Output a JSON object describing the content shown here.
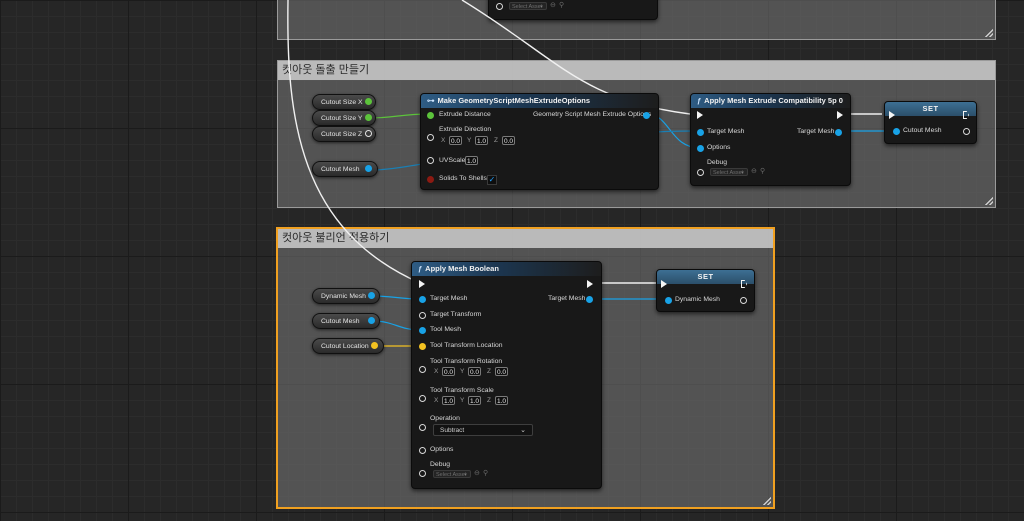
{
  "colors": {
    "object_pin": "#18a2e6",
    "float_pin": "#5cc33b",
    "vector_pin": "#f3c221",
    "selection": "#f0a020",
    "exec": "#f4f4f4"
  },
  "top_fragment": {
    "asset_placeholder": "Select Asset"
  },
  "comment1": {
    "title": "컷아웃 돌출 만들기",
    "variables": [
      {
        "label": "Cutout Size X"
      },
      {
        "label": "Cutout Size Y"
      },
      {
        "label": "Cutout Size Z"
      },
      {
        "label": "Cutout Mesh"
      }
    ],
    "make_node": {
      "title": "Make GeometryScriptMeshExtrudeOptions",
      "extrude_distance": "Extrude Distance",
      "extrude_direction": "Extrude Direction",
      "dir": {
        "x_axis": "X",
        "x": "0.0",
        "y_axis": "Y",
        "y": "1.0",
        "z_axis": "Z",
        "z": "0.0"
      },
      "uvscale": "UVScale",
      "uvscale_value": "1.0",
      "solids_to_shells": "Solids To Shells",
      "solids_checked": "✓",
      "output": "Geometry Script Mesh Extrude Options"
    },
    "apply_node": {
      "title": "Apply Mesh Extrude Compatibility 5p 0",
      "target_mesh_in": "Target Mesh",
      "options": "Options",
      "debug": "Debug",
      "asset_placeholder": "Select Asset",
      "target_mesh_out": "Target Mesh"
    },
    "set_node": {
      "title": "SET",
      "pin": "Cutout Mesh"
    }
  },
  "comment2": {
    "title": "컷아웃 불리언 적용하기",
    "variables": [
      {
        "label": "Dynamic Mesh"
      },
      {
        "label": "Cutout Mesh"
      },
      {
        "label": "Cutout Location"
      }
    ],
    "boolean_node": {
      "title": "Apply Mesh Boolean",
      "target_mesh": "Target Mesh",
      "target_transform": "Target Transform",
      "tool_mesh": "Tool Mesh",
      "tool_transform_location": "Tool Transform Location",
      "tool_transform_rotation": "Tool Transform Rotation",
      "rot": {
        "x_axis": "X",
        "x": "0.0",
        "y_axis": "Y",
        "y": "0.0",
        "z_axis": "Z",
        "z": "0.0"
      },
      "tool_transform_scale": "Tool Transform Scale",
      "scale": {
        "x_axis": "X",
        "x": "1.0",
        "y_axis": "Y",
        "y": "1.0",
        "z_axis": "Z",
        "z": "1.0"
      },
      "operation": "Operation",
      "operation_value": "Subtract",
      "options": "Options",
      "debug": "Debug",
      "asset_placeholder": "Select Asset",
      "target_mesh_out": "Target Mesh"
    },
    "set_node": {
      "title": "SET",
      "pin": "Dynamic Mesh"
    }
  }
}
